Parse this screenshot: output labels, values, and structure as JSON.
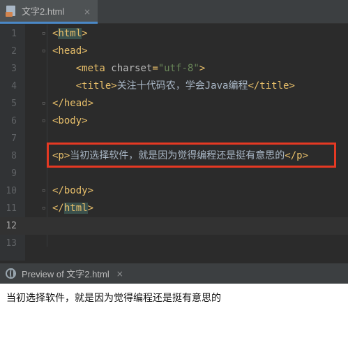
{
  "editor_tab": {
    "title": "文字2.html",
    "icon": "html-file-icon",
    "close": "×"
  },
  "editor": {
    "lines": [
      {
        "n": "1",
        "parts": [
          [
            "tag",
            "<"
          ],
          [
            "tag_hl",
            "html"
          ],
          [
            "tag",
            ">"
          ]
        ]
      },
      {
        "n": "2",
        "parts": [
          [
            "tag",
            "<head>"
          ]
        ]
      },
      {
        "n": "3",
        "parts": [
          [
            "text",
            "    "
          ],
          [
            "tag",
            "<meta "
          ],
          [
            "attr",
            "charset"
          ],
          [
            "tag",
            "="
          ],
          [
            "str",
            "\"utf-8\""
          ],
          [
            "tag",
            ">"
          ]
        ]
      },
      {
        "n": "4",
        "parts": [
          [
            "text",
            "    "
          ],
          [
            "tag",
            "<title>"
          ],
          [
            "text",
            "关注十代码农，学会Java编程"
          ],
          [
            "tag",
            "</title>"
          ]
        ]
      },
      {
        "n": "5",
        "parts": [
          [
            "tag",
            "</head>"
          ]
        ]
      },
      {
        "n": "6",
        "parts": [
          [
            "tag",
            "<body>"
          ]
        ]
      },
      {
        "n": "7",
        "parts": []
      },
      {
        "n": "8",
        "parts": [
          [
            "tag",
            "<p>"
          ],
          [
            "text",
            "当初选择软件，就是因为觉得编程还是挺有意思的"
          ],
          [
            "tag",
            "</p>"
          ]
        ]
      },
      {
        "n": "9",
        "parts": []
      },
      {
        "n": "10",
        "parts": [
          [
            "tag",
            "</body>"
          ]
        ]
      },
      {
        "n": "11",
        "parts": [
          [
            "tag",
            "</"
          ],
          [
            "tag_hl",
            "html"
          ],
          [
            "tag",
            ">"
          ]
        ]
      },
      {
        "n": "12",
        "parts": []
      },
      {
        "n": "13",
        "parts": []
      }
    ],
    "current_line": "12",
    "colors": {
      "tag": "#e8bf6a",
      "attr": "#bababa",
      "string": "#6a8759",
      "text": "#a9b7c6",
      "highlight_box": "#e53923"
    }
  },
  "preview": {
    "title": "Preview of  文字2.html",
    "icon": "globe-icon",
    "close": "×",
    "content": "当初选择软件，就是因为觉得编程还是挺有意思的"
  }
}
